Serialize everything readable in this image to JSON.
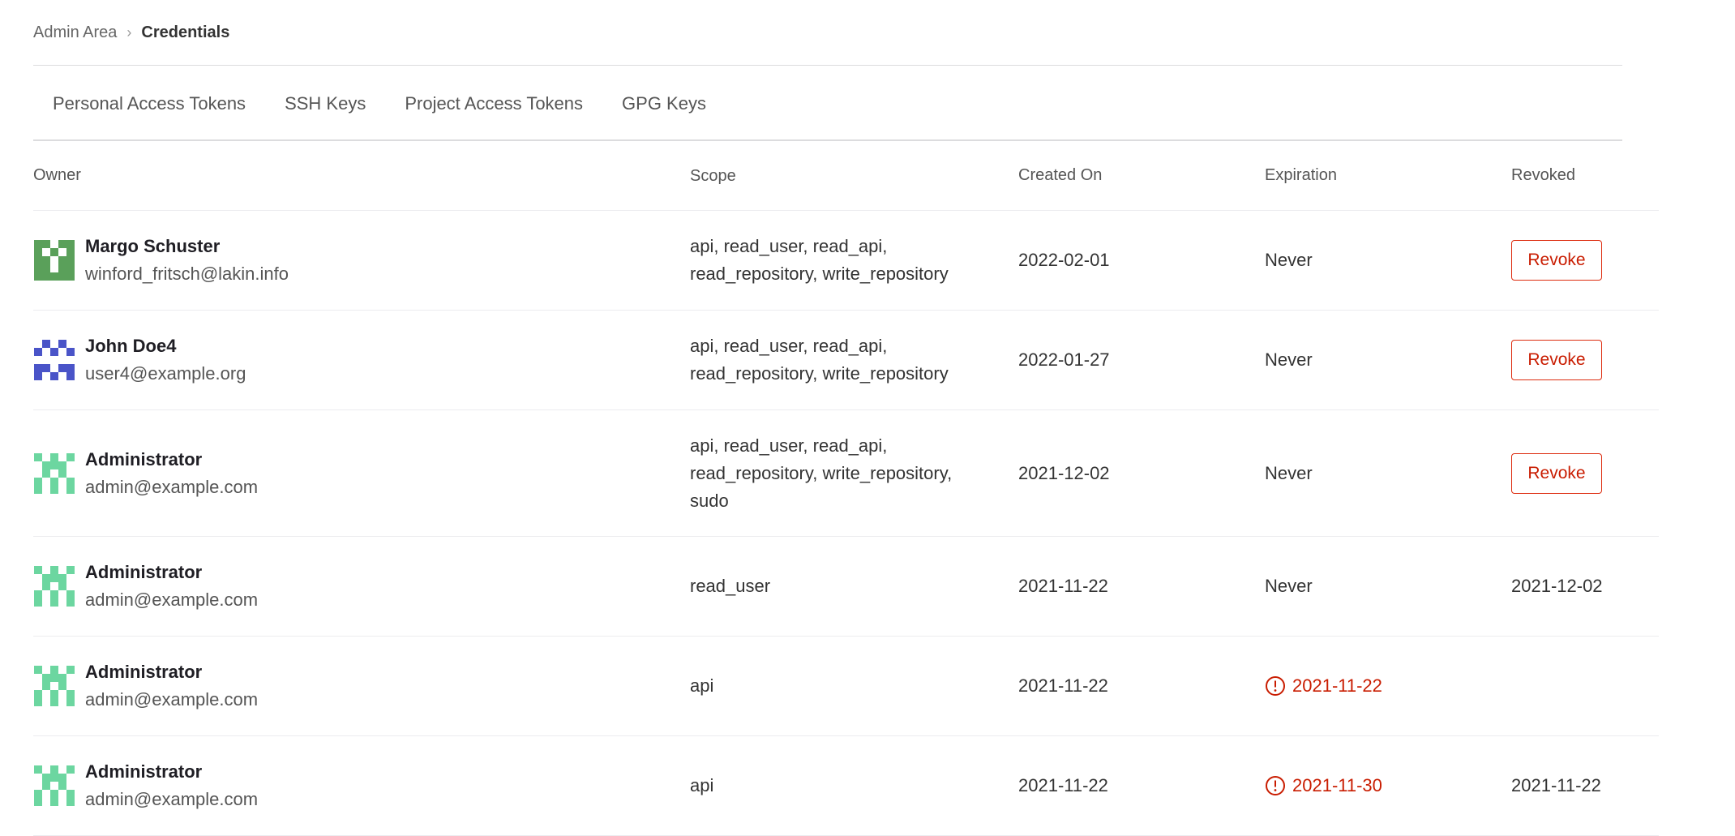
{
  "breadcrumb": {
    "parent": "Admin Area",
    "current": "Credentials"
  },
  "tabs": [
    {
      "label": "Personal Access Tokens",
      "active": true
    },
    {
      "label": "SSH Keys",
      "active": false
    },
    {
      "label": "Project Access Tokens",
      "active": false
    },
    {
      "label": "GPG Keys",
      "active": false
    }
  ],
  "table": {
    "headers": {
      "owner": "Owner",
      "scope": "Scope",
      "created": "Created On",
      "expiration": "Expiration",
      "revoked": "Revoked"
    },
    "revoke_label": "Revoke",
    "rows": [
      {
        "name": "Margo Schuster",
        "email": "winford_fritsch@lakin.info",
        "scope_lines": [
          "api, read_user, read_api,",
          "read_repository, write_repository"
        ],
        "created": "2022-02-01",
        "expiration": "Never",
        "expired": false,
        "revoked": "",
        "has_revoke_button": true,
        "avatar_color": "#5aa05a"
      },
      {
        "name": "John Doe4",
        "email": "user4@example.org",
        "scope_lines": [
          "api, read_user, read_api,",
          "read_repository, write_repository"
        ],
        "created": "2022-01-27",
        "expiration": "Never",
        "expired": false,
        "revoked": "",
        "has_revoke_button": true,
        "avatar_color": "#4a54c8"
      },
      {
        "name": "Administrator",
        "email": "admin@example.com",
        "scope_lines": [
          "api, read_user, read_api,",
          "read_repository, write_repository,",
          "sudo"
        ],
        "created": "2021-12-02",
        "expiration": "Never",
        "expired": false,
        "revoked": "",
        "has_revoke_button": true,
        "avatar_color": "#6cd6a0"
      },
      {
        "name": "Administrator",
        "email": "admin@example.com",
        "scope_lines": [
          "read_user"
        ],
        "created": "2021-11-22",
        "expiration": "Never",
        "expired": false,
        "revoked": "2021-12-02",
        "has_revoke_button": false,
        "avatar_color": "#6cd6a0"
      },
      {
        "name": "Administrator",
        "email": "admin@example.com",
        "scope_lines": [
          "api"
        ],
        "created": "2021-11-22",
        "expiration": "2021-11-22",
        "expired": true,
        "revoked": "",
        "has_revoke_button": false,
        "avatar_color": "#6cd6a0"
      },
      {
        "name": "Administrator",
        "email": "admin@example.com",
        "scope_lines": [
          "api"
        ],
        "created": "2021-11-22",
        "expiration": "2021-11-30",
        "expired": true,
        "revoked": "2021-11-22",
        "has_revoke_button": false,
        "avatar_color": "#6cd6a0"
      }
    ]
  },
  "colors": {
    "accent_tab": "#6666c4",
    "danger": "#c91c00",
    "border": "#dcdcde"
  }
}
